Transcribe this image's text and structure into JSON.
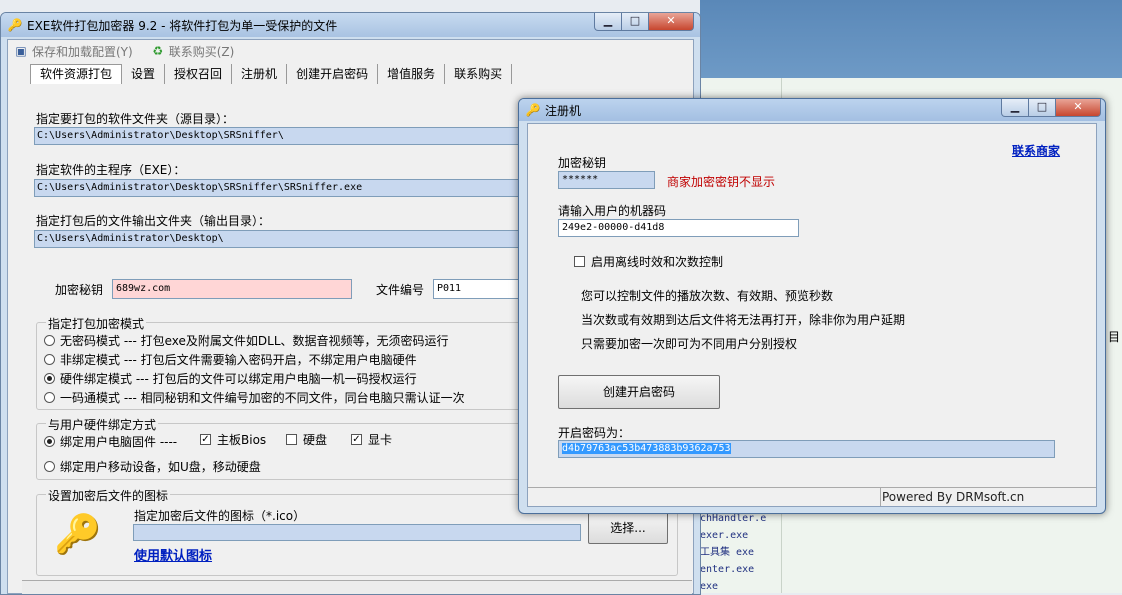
{
  "main_window": {
    "title": "EXE软件打包加密器 9.2 - 将软件打包为单一受保护的文件",
    "menu": [
      {
        "label": "保存和加载配置(Y)",
        "icon": "save-icon"
      },
      {
        "label": "联系购买(Z)",
        "icon": "recycle-icon"
      }
    ],
    "tabs": [
      "软件资源打包",
      "设置",
      "授权召回",
      "注册机",
      "创建开启密码",
      "增值服务",
      "联系购买"
    ],
    "source_dir_label": "指定要打包的软件文件夹（源目录）：",
    "source_dir_value": "C:\\Users\\Administrator\\Desktop\\SRSniffer\\",
    "main_exe_label": "指定软件的主程序（EXE）：",
    "main_exe_value": "C:\\Users\\Administrator\\Desktop\\SRSniffer\\SRSniffer.exe",
    "output_dir_label": "指定打包后的文件输出文件夹（输出目录）：",
    "output_dir_value": "C:\\Users\\Administrator\\Desktop\\",
    "key_label": "加密秘钥",
    "key_value": "689wz.com",
    "file_no_label": "文件编号",
    "file_no_value": "P011",
    "mode_group_title": "指定打包加密模式",
    "modes": [
      {
        "label": "无密码模式 --- 打包exe及附属文件如DLL、数据音视频等，无须密码运行",
        "selected": false
      },
      {
        "label": "非绑定模式 --- 打包后文件需要输入密码开启，不绑定用户电脑硬件",
        "selected": false
      },
      {
        "label": "硬件绑定模式 --- 打包后的文件可以绑定用户电脑一机一码授权运行",
        "selected": true
      },
      {
        "label": "一码通模式 --- 相同秘钥和文件编号加密的不同文件，同台电脑只需认证一次",
        "selected": false
      }
    ],
    "hw_group_title": "与用户硬件绑定方式",
    "hw_bind_pc": "绑定用户电脑固件 ----",
    "hw_options": [
      {
        "label": "主板Bios",
        "checked": true
      },
      {
        "label": "硬盘",
        "checked": false
      },
      {
        "label": "显卡",
        "checked": true
      }
    ],
    "hw_bind_mobile": "绑定用户移动设备，如U盘，移动硬盘",
    "icon_group_title": "设置加密后文件的图标",
    "icon_label": "指定加密后文件的图标（*.ico）",
    "icon_value": "",
    "choose_button": "选择...",
    "default_icon_link": "使用默认图标"
  },
  "dialog": {
    "title": "注册机",
    "contact_link": "联系商家",
    "key_label": "加密秘钥",
    "key_value": "******",
    "key_note": "商家加密密钥不显示",
    "machine_code_label": "请输入用户的机器码",
    "machine_code_value": "249e2-00000-d41d8",
    "offline_option": "启用离线时效和次数控制",
    "offline_checked": false,
    "info_lines": [
      "您可以控制文件的播放次数、有效期、预览秒数",
      "当次数或有效期到达后文件将无法再打开，除非你为用户延期",
      "只需要加密一次即可为不同用户分别授权"
    ],
    "create_button": "创建开启密码",
    "password_label": "开启密码为：",
    "password_value": "d4b79763ac53b473883b9362a753",
    "status_text": "Powered By DRMsoft.cn"
  },
  "background": {
    "lines": [
      "chHandler.e",
      "exer.exe",
      "工具集 exe",
      "enter.exe",
      "exe"
    ],
    "right_text": "目"
  },
  "colors": {
    "path_bg": "#c8d8ef",
    "key_bg": "#ffd6d6",
    "selected_text_bg": "#3399ff",
    "link": "#0020c0",
    "note_red": "#c00000"
  }
}
